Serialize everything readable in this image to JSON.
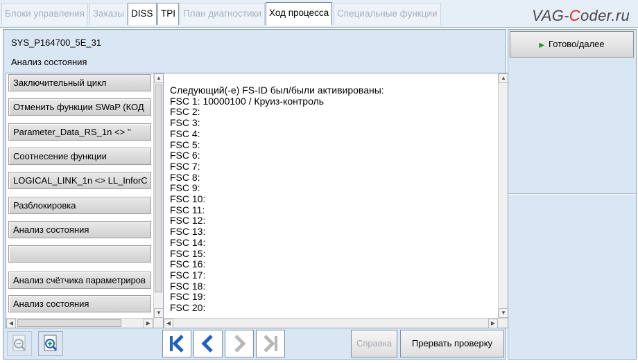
{
  "tabs": [
    {
      "label": "Блоки управления",
      "state": "disabled"
    },
    {
      "label": "Заказы",
      "state": "disabled"
    },
    {
      "label": "DISS",
      "state": "enabled"
    },
    {
      "label": "TPI",
      "state": "enabled"
    },
    {
      "label": "План диагностики",
      "state": "disabled"
    },
    {
      "label": "Ход процесса",
      "state": "active"
    },
    {
      "label": "Специальные функции",
      "state": "disabled"
    }
  ],
  "watermark": {
    "part1": "VAG-",
    "part2": "C",
    "part3": "oder.ru"
  },
  "header": {
    "code": "SYS_P164700_5E_31",
    "subtitle": "Анализ состояния"
  },
  "steps": [
    "Заключительный цикл",
    "Отменить функции SWaP (КОД",
    "Parameter_Data_RS_1n <> ''",
    "Соотнесение функции",
    "LOGICAL_LINK_1n <> LL_InforC",
    "Разблокировка",
    "Анализ состояния",
    "",
    "Анализ счётчика параметриров",
    "Анализ состояния"
  ],
  "output_lines": [
    "Следующий(-е) FS-ID был/были активированы:",
    "FSC 1: 10000100 / Круиз-контроль",
    "FSC 2:",
    "FSC 3:",
    "FSC 4:",
    "FSC 5:",
    "FSC 6:",
    "FSC 7:",
    "FSC 8:",
    "FSC 9:",
    "FSC 10:",
    "FSC 11:",
    "FSC 12:",
    "FSC 13:",
    "FSC 14:",
    "FSC 15:",
    "FSC 16:",
    "FSC 17:",
    "FSC 18:",
    "FSC 19:",
    "FSC 20:"
  ],
  "buttons": {
    "done": "Готово/далее",
    "help": "Справка",
    "abort": "Прервать проверку"
  },
  "icons": {
    "zoom_out": "zoom-out-icon",
    "zoom_in": "zoom-in-icon",
    "first": "skip-first-icon",
    "prev": "chevron-left-icon",
    "next": "chevron-right-icon",
    "last": "skip-last-icon"
  },
  "colors": {
    "accent_blue": "#1f5fc4",
    "go_green": "#1e9c1e",
    "panel_bg": "#d9e6f3",
    "watermark_red": "#e0281d"
  }
}
